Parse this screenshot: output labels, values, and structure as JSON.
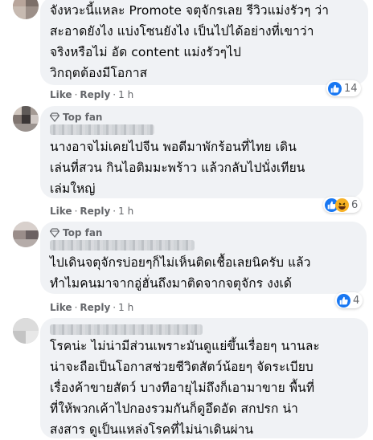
{
  "comments": [
    {
      "top_fan": "",
      "lines": [
        "จังหวะนี้แหละ Promote จตุจักรเลย รีวิวแม่งรัวๆ ว่า",
        "สะอาดยังไง แบ่งโซนยังไง เป็นไปได้อย่างที่เขาว่า",
        "จริงหรือไม่ อัด content แม่งรัวๆไป",
        "วิกฤตต้องมีโอกาส"
      ],
      "like_label": "Like",
      "reply_label": "Reply",
      "separator": "·",
      "time": "1 h",
      "reaction_count": "14"
    },
    {
      "top_fan": "Top fan",
      "lines": [
        "นางอาจไม่เคยไปจีน พอดีมาพักร้อนที่ไทย เดิน",
        "เล่นที่สวน กินไอติมมะพร้าว แล้วกลับไปนั่งเทียน",
        "เล่มใหญ่"
      ],
      "like_label": "Like",
      "reply_label": "Reply",
      "separator": "·",
      "time": "1 h",
      "reaction_count": "6"
    },
    {
      "top_fan": "Top fan",
      "lines": [
        "ไปเดินจตุจักรบ่อยๆก็ไม่เห็นติดเชื้อเลยนิครับ แล้ว",
        "ทำไมคนมาจากอู่ฮั่นถึงมาติดจากจตุจักร งงเด้"
      ],
      "like_label": "Like",
      "reply_label": "Reply",
      "separator": "·",
      "time": "1 h",
      "reaction_count": "4"
    },
    {
      "top_fan": "",
      "lines": [
        "โรคน่ะ ไม่น่ามีส่วนเพราะมันดูแย่ขึ้นเรื่อยๆ นานละ",
        "น่าจะถือเป็นโอกาสช่วยชีวิตสัตว์น้อยๆ จัดระเบียบ",
        "เรื่องค้าขายสัตว์ บางทีอายุไม่ถึงก็เอามาขาย พื้นที่",
        "ที่ให้พวกเค้าไปกองรวมกันก็ดูอึดอัด สกปรก น่า",
        "สงสาร ดูเป็นแหล่งโรคที่ไม่น่าเดินผ่าน"
      ]
    }
  ],
  "colors": {
    "bubble": "#f0f2f5",
    "meta": "#65676b",
    "like_blue": "#1877f2",
    "haha_yellow": "#f7b125"
  },
  "icons": {
    "top_fan": "diamond-icon",
    "like": "thumbs-up-icon",
    "haha": "laughing-face-icon"
  }
}
